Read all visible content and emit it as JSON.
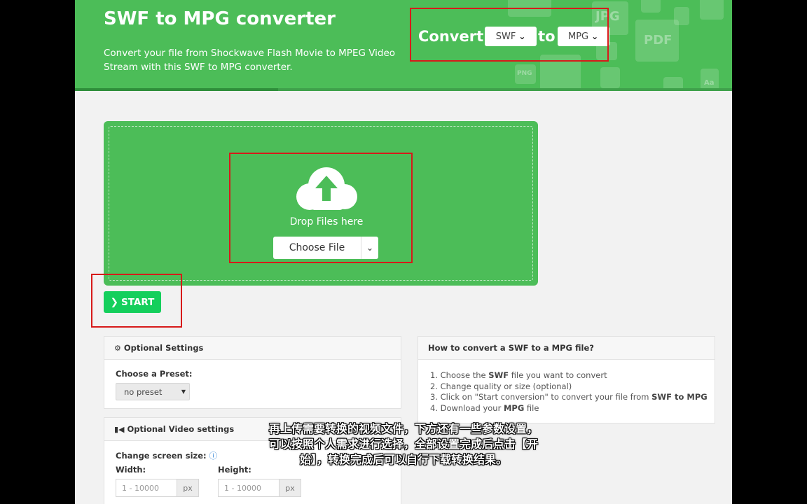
{
  "header": {
    "title": "SWF to MPG converter",
    "subtitle": "Convert your file from Shockwave Flash Movie to MPEG Video Stream with this SWF to MPG converter.",
    "convert_label": "Convert",
    "from_format": "SWF",
    "to_label": "to",
    "to_format": "MPG",
    "decor_labels": [
      "JPG",
      "PDF",
      "PNG",
      "Aa"
    ],
    "accent_color": "#4cbd58"
  },
  "upload": {
    "drop_label": "Drop Files here",
    "choose_label": "Choose File",
    "icon": "cloud-upload-icon"
  },
  "start": {
    "label": "START",
    "color": "#14cf5c"
  },
  "optional_settings": {
    "title": "Optional Settings",
    "preset_label": "Choose a Preset:",
    "preset_value": "no preset"
  },
  "video_settings": {
    "title": "Optional Video settings",
    "screen_size_label": "Change screen size:",
    "width_label": "Width:",
    "height_label": "Height:",
    "width_placeholder": "1 - 10000",
    "height_placeholder": "1 - 10000",
    "unit": "px"
  },
  "howto": {
    "title": "How to convert a SWF to a MPG file?",
    "steps": [
      {
        "pre": "1. Choose the ",
        "bold": "SWF",
        "post": " file you want to convert"
      },
      {
        "pre": "2. Change quality or size (optional)",
        "bold": "",
        "post": ""
      },
      {
        "pre": "3. Click on \"Start conversion\" to convert your file from ",
        "bold": "SWF to MPG",
        "post": ""
      },
      {
        "pre": "4. Download your ",
        "bold": "MPG",
        "post": " file"
      }
    ]
  },
  "caption": {
    "line1": "再上传需要转换的视频文件，下方还有一些参数设置，",
    "line2": "可以按照个人需求进行选择，全部设置完成后点击【开",
    "line3": "始】，转换完成后可以自行下载转换结果。"
  }
}
